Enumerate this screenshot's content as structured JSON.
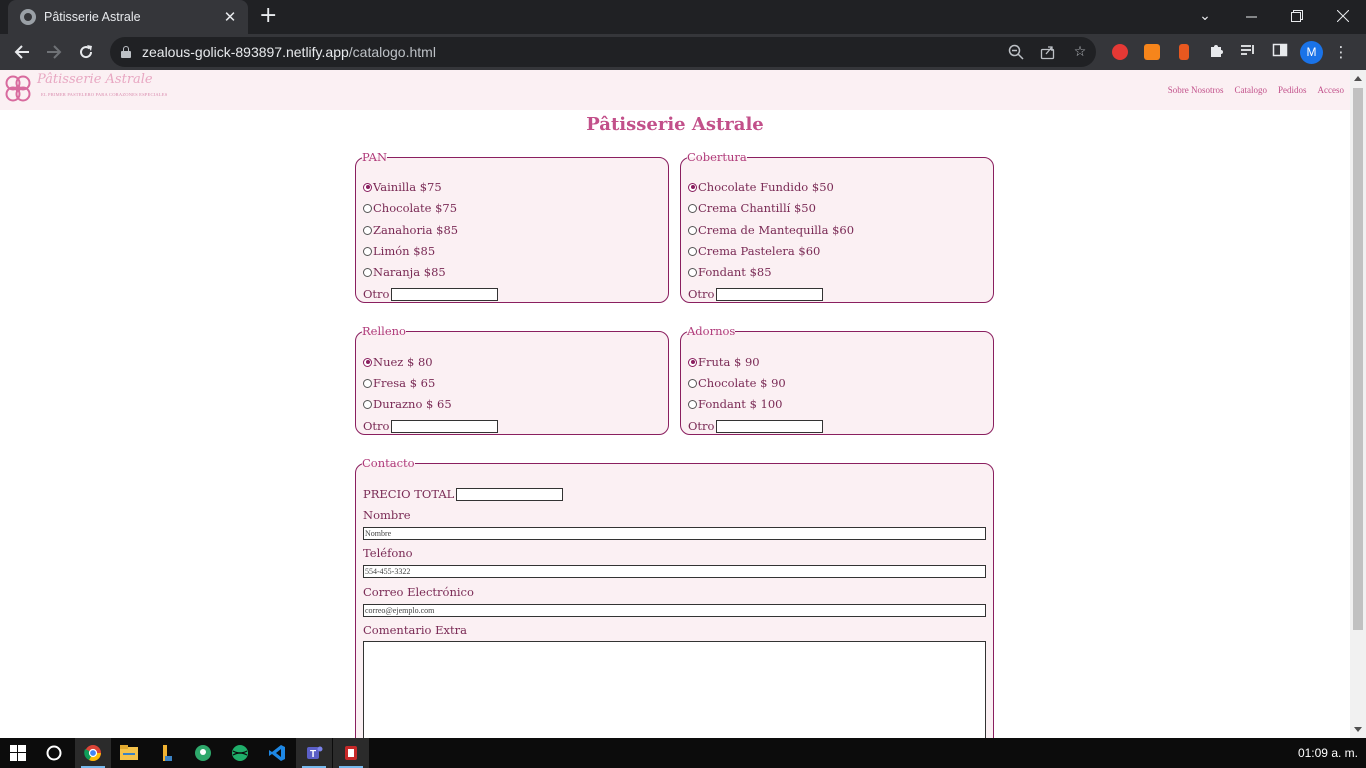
{
  "browser": {
    "tab_title": "Pâtisserie Astrale",
    "url_host": "zealous-golick-893897.netlify.app",
    "url_path": "/catalogo.html",
    "profile_initial": "M"
  },
  "site": {
    "logo_text": "Pâtisserie Astrale",
    "logo_subtitle": "EL PRIMER PASTELERO PARA CORAZONES ESPECIALES",
    "nav": [
      "Sobre Nosotros",
      "Catalogo",
      "Pedidos",
      "Acceso"
    ],
    "page_title": "Pâtisserie Astrale",
    "accent_color": "#c2508a",
    "border_color": "#8a1f5f"
  },
  "form": {
    "pan": {
      "legend": "PAN",
      "options": [
        "Vainilla $75",
        "Chocolate $75",
        "Zanahoria $85",
        "Limón $85",
        "Naranja $85"
      ],
      "selected": "Vainilla $75",
      "other_label": "Otro"
    },
    "cobertura": {
      "legend": "Cobertura",
      "options": [
        "Chocolate Fundido $50",
        "Crema Chantillí $50",
        "Crema de Mantequilla $60",
        "Crema Pastelera $60",
        "Fondant $85"
      ],
      "selected": "Chocolate Fundido $50",
      "other_label": "Otro"
    },
    "relleno": {
      "legend": "Relleno",
      "options": [
        "Nuez $ 80",
        "Fresa $ 65",
        "Durazno $ 65"
      ],
      "selected": "Nuez $ 80",
      "other_label": "Otro"
    },
    "adornos": {
      "legend": "Adornos",
      "options": [
        "Fruta $ 90",
        "Chocolate $ 90",
        "Fondant $ 100"
      ],
      "selected": "Fruta $ 90",
      "other_label": "Otro"
    },
    "contacto": {
      "legend": "Contacto",
      "precio_label": "PRECIO TOTAL",
      "nombre_label": "Nombre",
      "nombre_placeholder": "Nombre",
      "telefono_label": "Teléfono",
      "telefono_placeholder": "554-455-3322",
      "correo_label": "Correo Electrónico",
      "correo_placeholder": "correo@ejemplo.com",
      "comentario_label": "Comentario Extra"
    }
  },
  "taskbar": {
    "clock": "01:09 a. m."
  }
}
